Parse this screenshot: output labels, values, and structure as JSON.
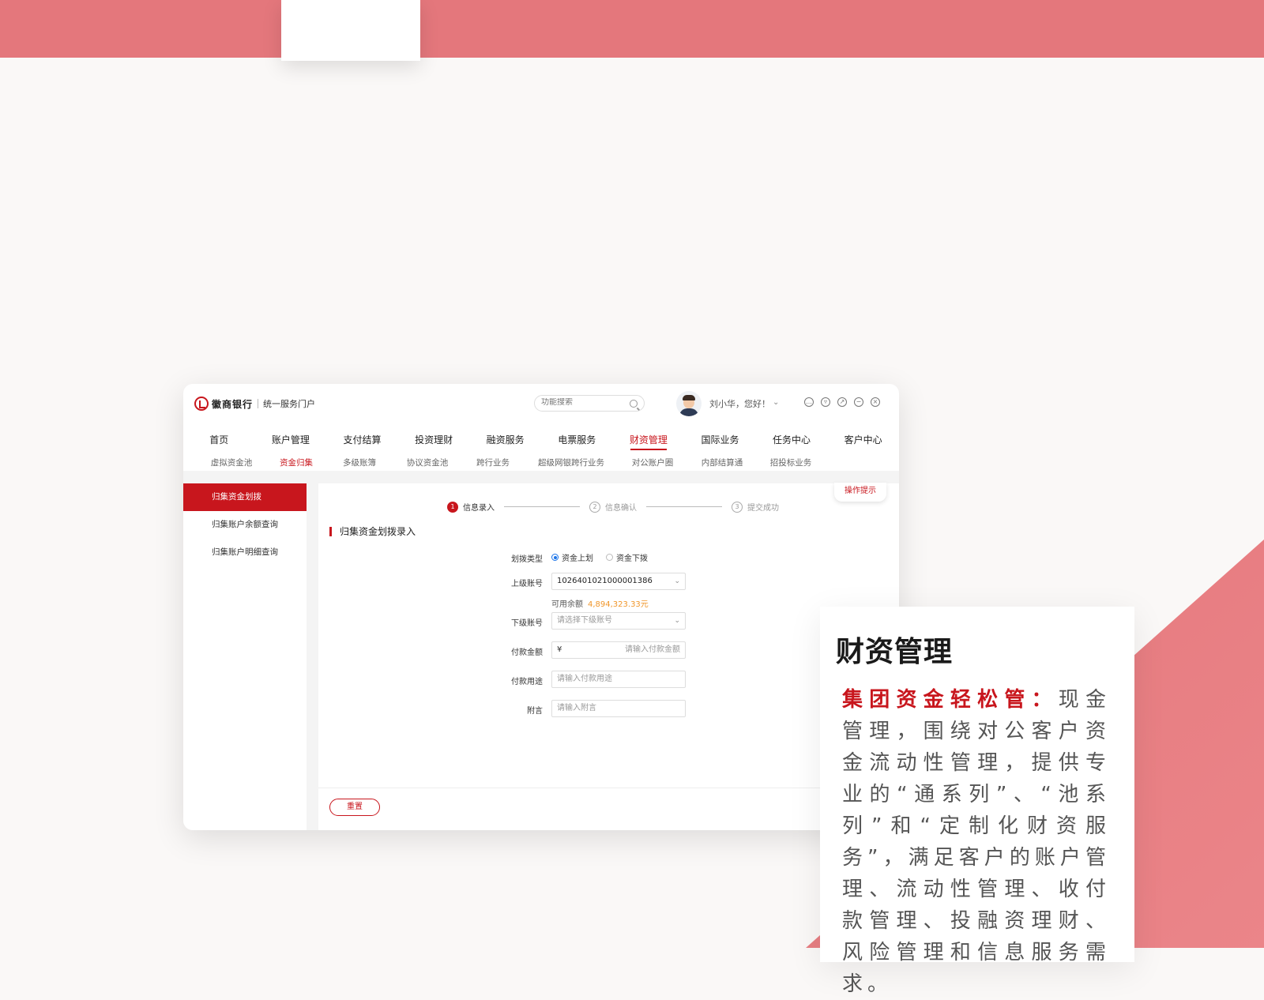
{
  "app": {
    "brand_name": "徽商银行",
    "brand_subtitle": "统一服务门户",
    "search_placeholder": "功能搜索",
    "user_greeting": "刘小华，您好！",
    "nav_main": [
      "首页",
      "账户管理",
      "支付结算",
      "投资理财",
      "融资服务",
      "电票服务",
      "财资管理",
      "国际业务",
      "任务中心",
      "客户中心"
    ],
    "nav_main_active": "财资管理",
    "nav_sub": [
      "虚拟资金池",
      "资金归集",
      "多级账簿",
      "协议资金池",
      "跨行业务",
      "超级网银跨行业务",
      "对公账户圈",
      "内部结算通",
      "招投标业务"
    ],
    "nav_sub_active": "资金归集",
    "sidebar": [
      "归集资金划拨",
      "归集账户余额查询",
      "归集账户明细查询"
    ],
    "tips_label": "操作提示",
    "steps": [
      {
        "num": "1",
        "label": "信息录入",
        "active": true
      },
      {
        "num": "2",
        "label": "信息确认",
        "active": false
      },
      {
        "num": "3",
        "label": "提交成功",
        "active": false
      }
    ],
    "section_title": "归集资金划拨录入",
    "form": {
      "type_label": "划拨类型",
      "type_options": [
        "资金上划",
        "资金下拨"
      ],
      "type_selected": "资金上划",
      "upper_label": "上级账号",
      "upper_value": "1026401021000001386",
      "balance_label": "可用余额",
      "balance_value": "4,894,323.33元",
      "lower_label": "下级账号",
      "lower_placeholder": "请选择下级账号",
      "amount_label": "付款金额",
      "amount_prefix": "¥",
      "amount_placeholder": "请输入付款金额",
      "purpose_label": "付款用途",
      "purpose_placeholder": "请输入付款用途",
      "note_label": "附言",
      "note_placeholder": "请输入附言"
    },
    "reset_label": "重置"
  },
  "card": {
    "title": "财资管理",
    "highlight": "集团资金轻松管：",
    "body": "现金管理，围绕对公客户资金流动性管理，提供专业的“通系列”、“池系列”和“定制化财资服务”，满足客户的账户管理、流动性管理、收付款管理、投融资理财、风险管理和信息服务需求。"
  },
  "colors": {
    "brand_red": "#c8161d",
    "band_pink": "#e4777c",
    "balance_orange": "#f0962a"
  }
}
